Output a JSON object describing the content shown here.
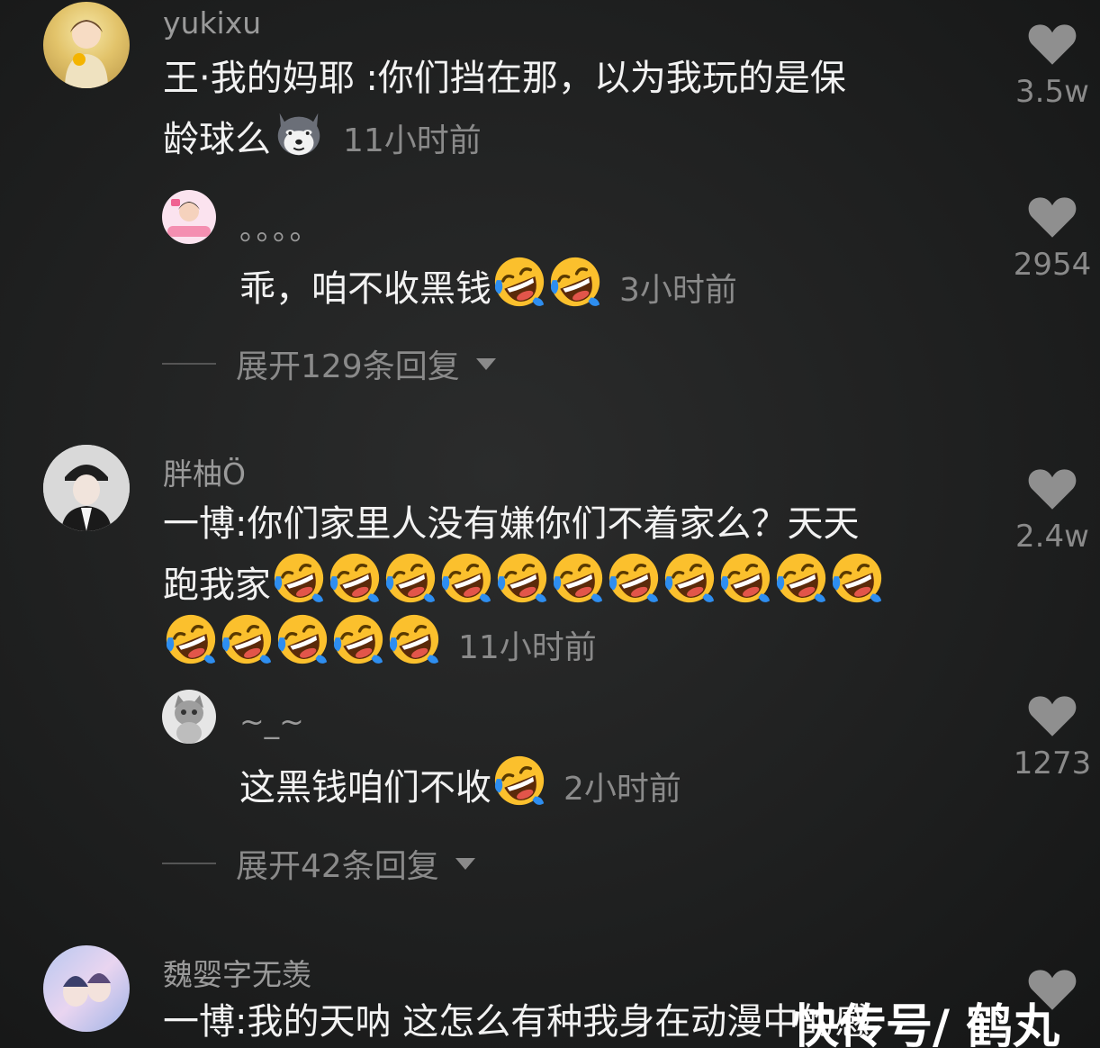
{
  "comments": [
    {
      "username": "yukixu",
      "text_line1": "王·我的妈耶 :你们挡在那，以为我玩的是保",
      "text_line2": "龄球么",
      "time": "11小时前",
      "likes": "3.5w",
      "reply": {
        "username": "。。。。",
        "text": "乖，咱不收黑钱",
        "time": "3小时前",
        "likes": "2954"
      },
      "expand_label": "展开129条回复"
    },
    {
      "username": "胖柚Ö",
      "text_line1": "一博:你们家里人没有嫌你们不着家么？天天",
      "text_line2": "跑我家",
      "time": "11小时前",
      "likes": "2.4w",
      "reply": {
        "username": "~_~",
        "text": "这黑钱咱们不收",
        "time": "2小时前",
        "likes": "1273"
      },
      "expand_label": "展开42条回复"
    },
    {
      "username": "魏婴字无羡",
      "text_line1": "一博:我的天呐 这怎么有种我身在动漫中的感",
      "likes": ""
    }
  ],
  "watermark": "快传号/ 鹤丸",
  "icons": {
    "like": "heart-icon",
    "laugh": "rofl-emoji-icon",
    "husky": "husky-emoji-icon",
    "expand": "caret-down-icon"
  },
  "colors": {
    "background": "#1f2020",
    "text_primary": "#f2f2f2",
    "text_secondary": "#8a8a8a",
    "heart": "#8f8f8f"
  }
}
